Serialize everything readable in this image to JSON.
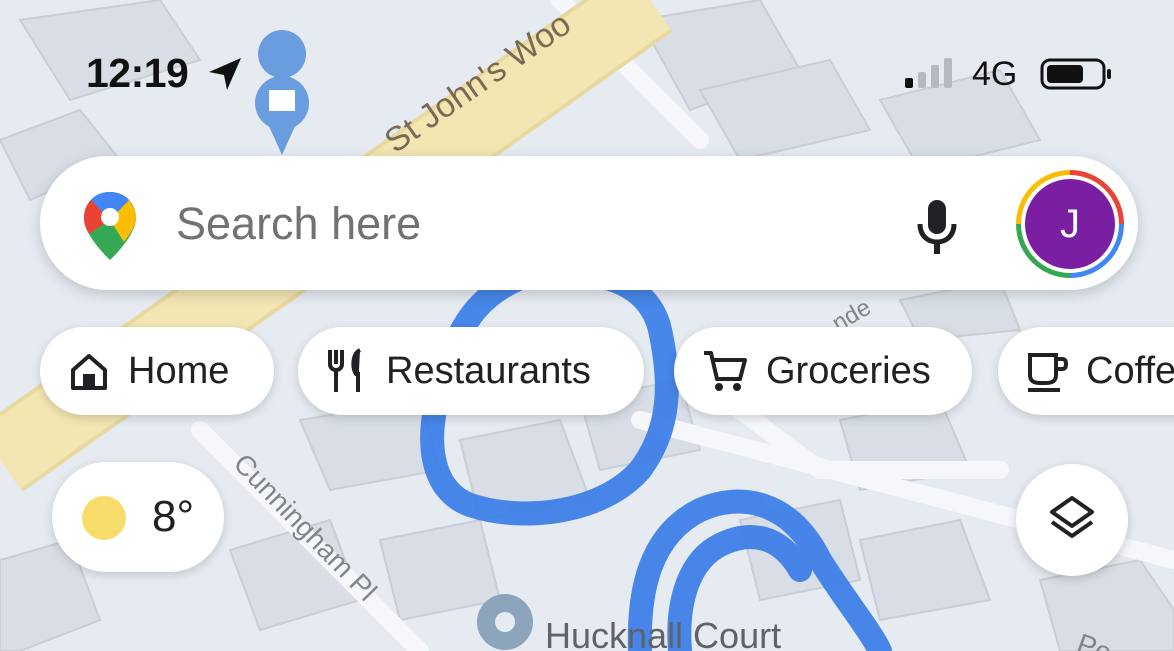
{
  "status_bar": {
    "time": "12:19",
    "network": "4G"
  },
  "search": {
    "placeholder": "Search here",
    "avatar_initial": "J"
  },
  "chips": [
    {
      "label": "Home",
      "icon": "home-icon"
    },
    {
      "label": "Restaurants",
      "icon": "fork-knife-icon"
    },
    {
      "label": "Groceries",
      "icon": "cart-icon"
    },
    {
      "label": "Coffe",
      "icon": "coffee-icon"
    }
  ],
  "weather": {
    "temperature": "8°",
    "icon": "sun-icon"
  },
  "map_labels": {
    "road_main": "St John's Woo",
    "road_side": "Cunningham Pl",
    "place": "Hucknall Court",
    "partial_top": "nde",
    "partial_right": "Po"
  },
  "colors": {
    "avatar_bg": "#7b1fa2",
    "annotation_blue": "#3a7ee8",
    "road_yellow": "#f3e6b3",
    "map_bg": "#e6ebf2"
  }
}
